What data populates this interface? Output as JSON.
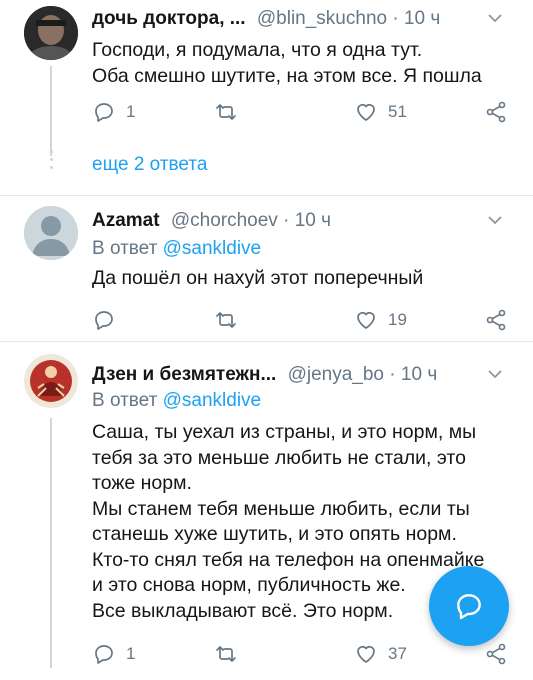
{
  "tweets": [
    {
      "name": "дочь доктора, ...",
      "handle": "@blin_skuchno",
      "dot": "·",
      "time": "10 ч",
      "body": "Господи, я подумала, что я одна тут.\nОба смешно шутите, на этом все. Я пошла",
      "reply_count": "1",
      "retweet_count": "",
      "like_count": "51"
    },
    {
      "name": "Azamat",
      "handle": "@chorchoev",
      "dot": "·",
      "time": "10 ч",
      "reply_prefix": "В ответ",
      "reply_mention": "@sankldive",
      "body": "Да пошёл он нахуй этот поперечный",
      "reply_count": "",
      "retweet_count": "",
      "like_count": "19"
    },
    {
      "name": "Дзен и безмятежн...",
      "handle": "@jenya_bo",
      "dot": "·",
      "time": "10 ч",
      "reply_prefix": "В ответ",
      "reply_mention": "@sankldive",
      "body": "Саша, ты уехал из страны, и это норм, мы\nтебя за это меньше любить не стали, это\nтоже норм.\nМы станем тебя меньше любить, если ты\nстанешь хуже шутить, и это опять норм.\nКто-то снял тебя на телефон на опенмайке\nи это снова норм, публичность же.\nВсе выкладывают всё. Это норм.",
      "reply_count": "1",
      "retweet_count": "",
      "like_count": "37"
    }
  ],
  "more_replies": "еще 2 ответа",
  "colors": {
    "accent": "#1da1f2",
    "secondary_text": "#657786",
    "divider": "#e1e8ed"
  },
  "icons": {
    "reply": "reply-icon",
    "retweet": "retweet-icon",
    "like": "heart-icon",
    "share": "share-icon",
    "caret": "chevron-down-icon",
    "compose": "compose-reply-icon"
  }
}
